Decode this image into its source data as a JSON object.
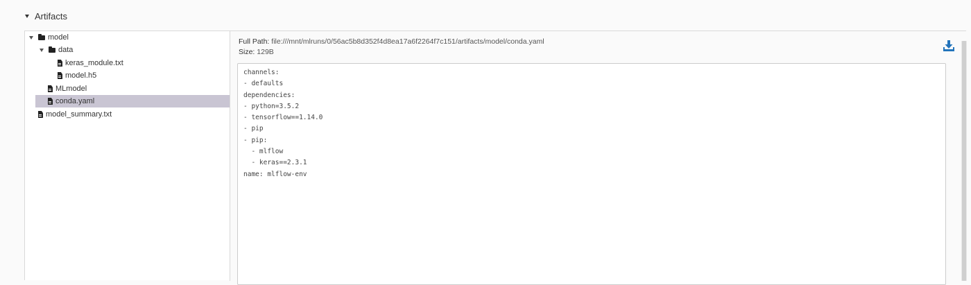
{
  "section": {
    "title": "Artifacts"
  },
  "tree": {
    "items": [
      {
        "label": "model",
        "type": "folder",
        "expanded": true
      },
      {
        "label": "data",
        "type": "folder",
        "expanded": true
      },
      {
        "label": "keras_module.txt",
        "type": "file"
      },
      {
        "label": "model.h5",
        "type": "file"
      },
      {
        "label": "MLmodel",
        "type": "file"
      },
      {
        "label": "conda.yaml",
        "type": "file",
        "selected": true
      },
      {
        "label": "model_summary.txt",
        "type": "file"
      }
    ]
  },
  "viewer": {
    "full_path_label": "Full Path:",
    "full_path_value": "file:///mnt/mlruns/0/56ac5b8d352f4d8ea17a6f2264f7c151/artifacts/model/conda.yaml",
    "size_label": "Size:",
    "size_value": "129B",
    "download_icon": "download-icon",
    "content": "channels:\n- defaults\ndependencies:\n- python=3.5.2\n- tensorflow==1.14.0\n- pip\n- pip:\n  - mlflow\n  - keras==2.3.1\nname: mlflow-env"
  },
  "colors": {
    "selected_row": "#c9c5d3",
    "download_icon": "#2374bb"
  }
}
